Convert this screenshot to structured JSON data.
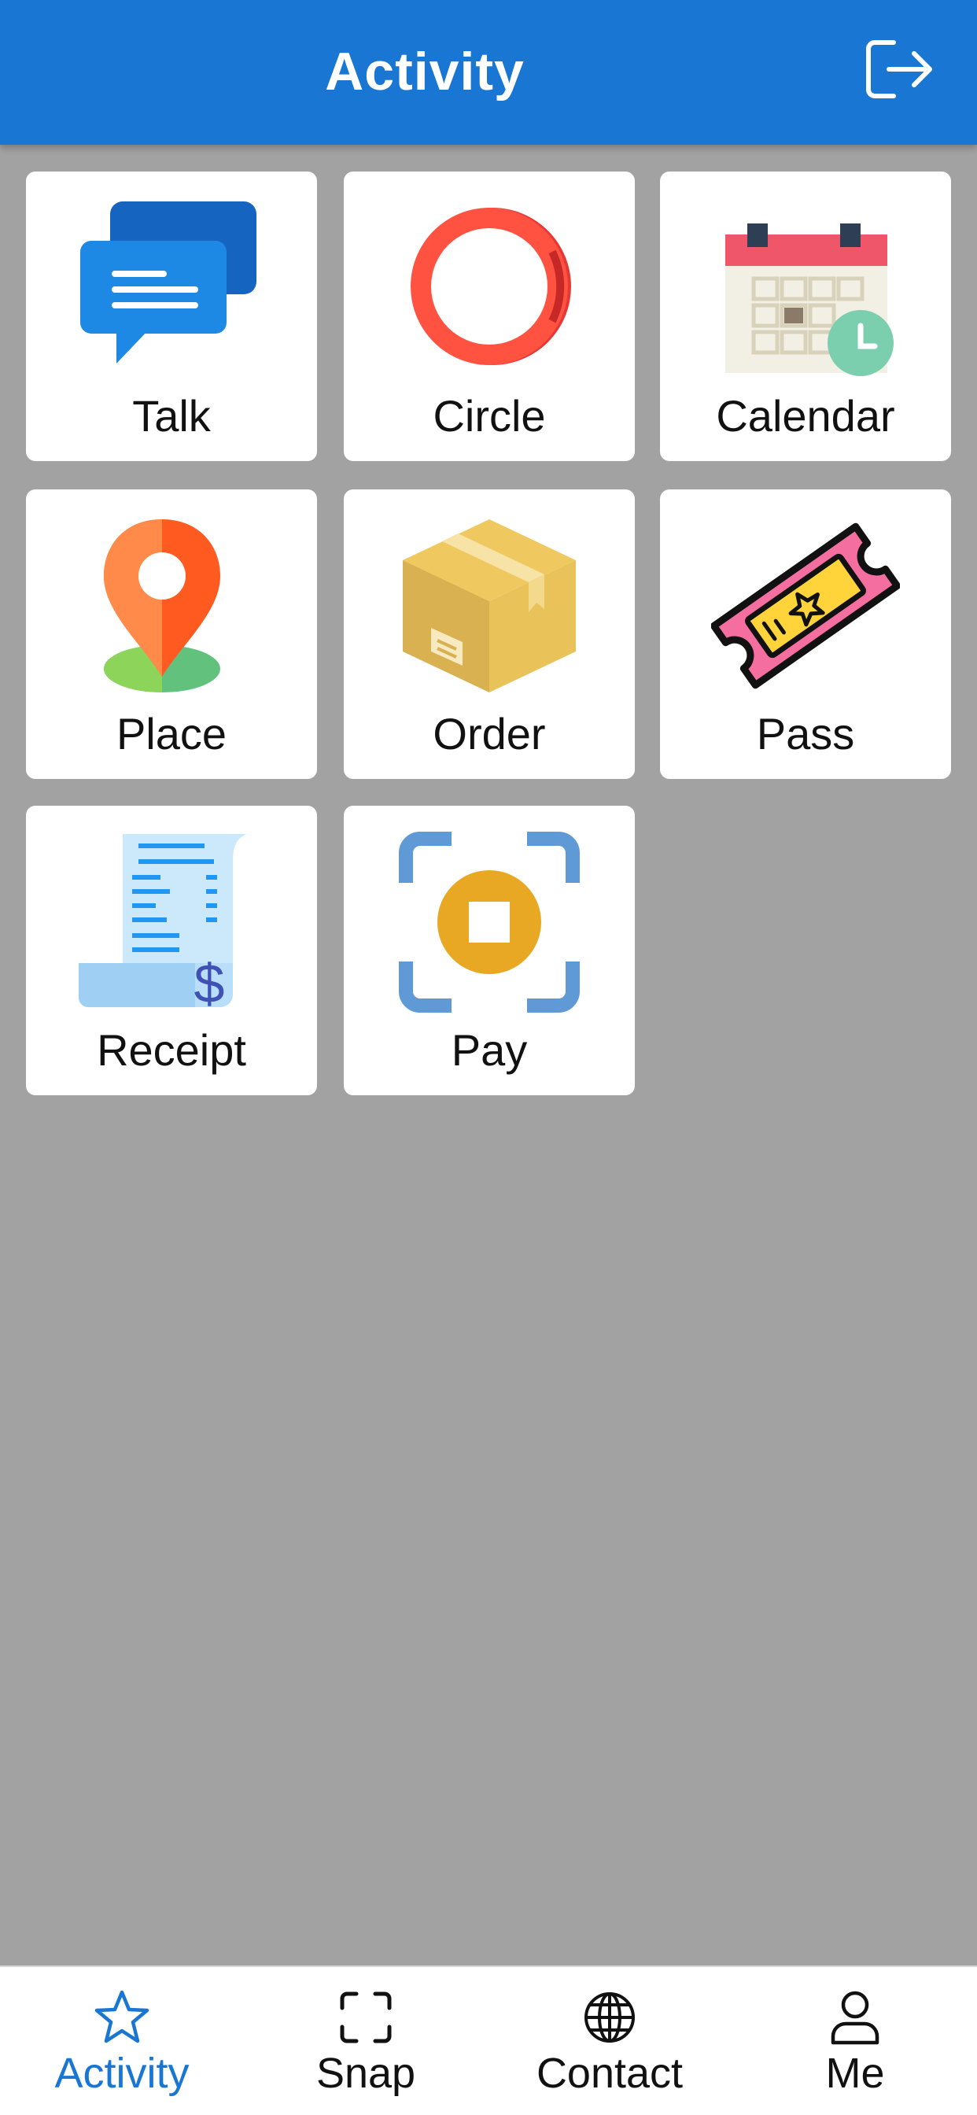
{
  "header": {
    "title": "Activity",
    "logout_icon": "logout-icon"
  },
  "tiles": [
    {
      "label": "Talk",
      "icon": "chat-bubbles-icon"
    },
    {
      "label": "Circle",
      "icon": "ring-icon"
    },
    {
      "label": "Calendar",
      "icon": "calendar-clock-icon"
    },
    {
      "label": "Place",
      "icon": "map-pin-icon"
    },
    {
      "label": "Order",
      "icon": "package-box-icon"
    },
    {
      "label": "Pass",
      "icon": "ticket-icon"
    },
    {
      "label": "Receipt",
      "icon": "receipt-icon"
    },
    {
      "label": "Pay",
      "icon": "scan-pay-icon"
    }
  ],
  "bottom_nav": {
    "items": [
      {
        "label": "Activity",
        "icon": "star-icon",
        "active": true
      },
      {
        "label": "Snap",
        "icon": "scan-frame-icon",
        "active": false
      },
      {
        "label": "Contact",
        "icon": "globe-icon",
        "active": false
      },
      {
        "label": "Me",
        "icon": "person-icon",
        "active": false
      }
    ]
  },
  "colors": {
    "header_bg": "#1976d2",
    "page_bg": "#a2a2a2",
    "active_nav": "#1976d2"
  }
}
